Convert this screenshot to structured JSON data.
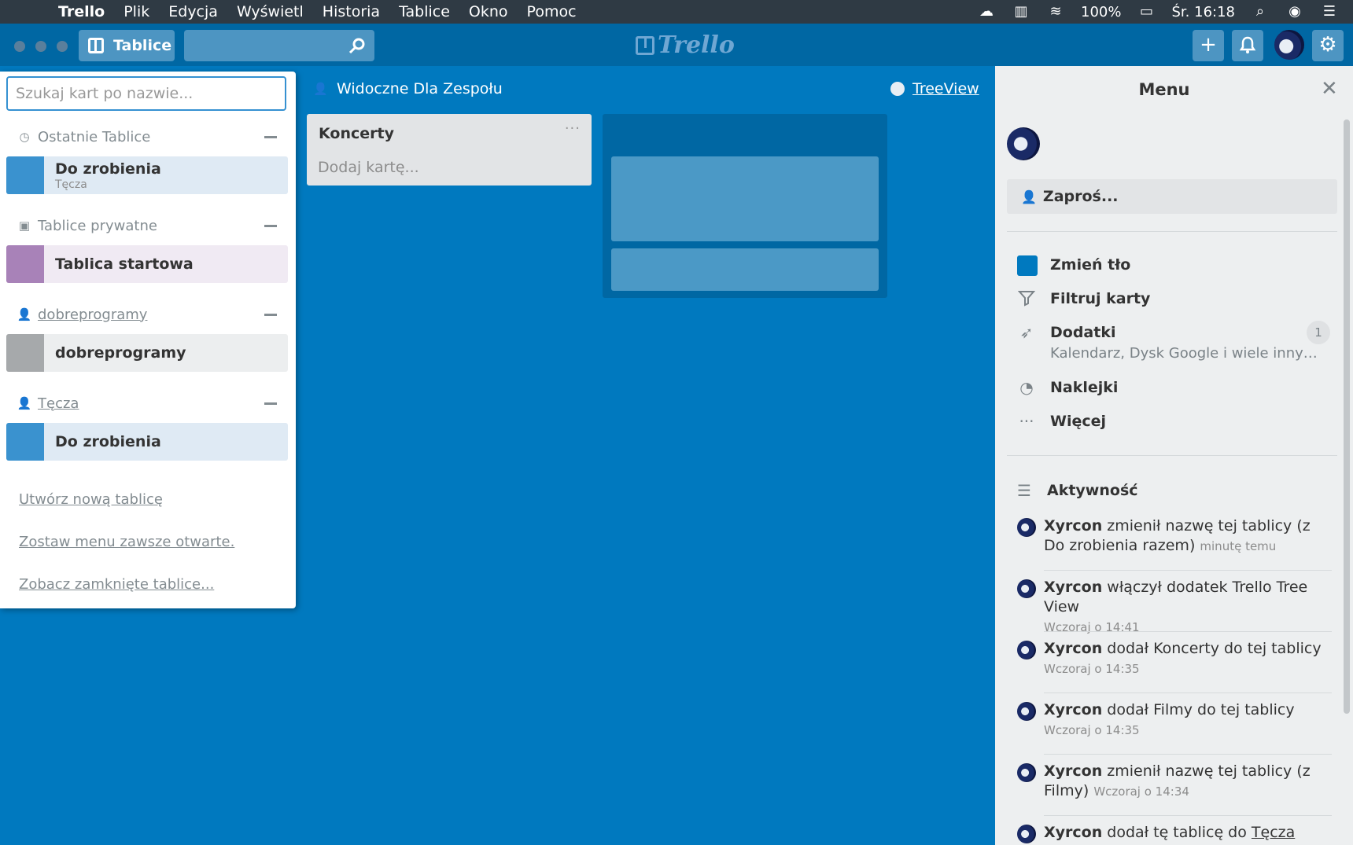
{
  "menubar": {
    "app": "Trello",
    "items": [
      "Plik",
      "Edycja",
      "Wyświetl",
      "Historia",
      "Tablice",
      "Okno",
      "Pomoc"
    ],
    "battery": "100%",
    "clock": "Śr. 16:18"
  },
  "header": {
    "boards_label": "Tablice",
    "logo": "Trello"
  },
  "drawer": {
    "search_placeholder": "Szukaj kart po nazwie...",
    "sections": [
      {
        "title": "Ostatnie Tablice",
        "boards": [
          {
            "name": "Do zrobienia",
            "team": "Tęcza",
            "color": "#3a92cf",
            "bg": "#dfeaf4"
          }
        ]
      },
      {
        "title": "Tablice prywatne",
        "boards": [
          {
            "name": "Tablica startowa",
            "color": "#a882b8",
            "bg": "#f0eaf3"
          }
        ]
      },
      {
        "title": "dobreprogramy",
        "boards": [
          {
            "name": "dobreprogramy",
            "color": "#a6a9ab",
            "bg": "#eceeef"
          }
        ]
      },
      {
        "title": "Tęcza",
        "boards": [
          {
            "name": "Do zrobienia",
            "color": "#3a92cf",
            "bg": "#dfeaf4"
          }
        ]
      }
    ],
    "links": [
      "Utwórz nową tablicę",
      "Zostaw menu zawsze otwarte.",
      "Zobacz zamknięte tablice..."
    ]
  },
  "board": {
    "visibility": "Widoczne Dla Zespołu",
    "powerup_link": "TreeView",
    "lists": [
      {
        "title": "Koncerty",
        "add_card": "Dodaj kartę..."
      }
    ]
  },
  "menu": {
    "title": "Menu",
    "invite": "Zaproś...",
    "items": [
      {
        "label": "Zmień tło",
        "icon": "color-square-icon",
        "color": "#0079bf"
      },
      {
        "label": "Filtruj karty",
        "icon": "filter-icon"
      },
      {
        "label": "Dodatki",
        "icon": "rocket-icon",
        "sub": "Kalendarz, Dysk Google i wiele innych...",
        "badge": "1"
      },
      {
        "label": "Naklejki",
        "icon": "sticker-icon"
      },
      {
        "label": "Więcej",
        "icon": "more-icon"
      }
    ],
    "activity_title": "Aktywność",
    "activity": [
      {
        "user": "Xyrcon",
        "text": " zmienił nazwę tej tablicy (z Do zrobienia razem) ",
        "time": "minutę temu"
      },
      {
        "user": "Xyrcon",
        "text": " włączył dodatek Trello Tree View",
        "time": "Wczoraj o 14:41"
      },
      {
        "user": "Xyrcon",
        "text": " dodał Koncerty do tej tablicy",
        "time": "Wczoraj o 14:35"
      },
      {
        "user": "Xyrcon",
        "text": " dodał Filmy do tej tablicy",
        "time": "Wczoraj o 14:35"
      },
      {
        "user": "Xyrcon",
        "text": " zmienił nazwę tej tablicy (z Filmy) ",
        "time": "Wczoraj o 14:34"
      },
      {
        "user": "Xyrcon",
        "text": " dodał tę tablicę do ",
        "link": "Tęcza",
        "time": ""
      }
    ]
  }
}
